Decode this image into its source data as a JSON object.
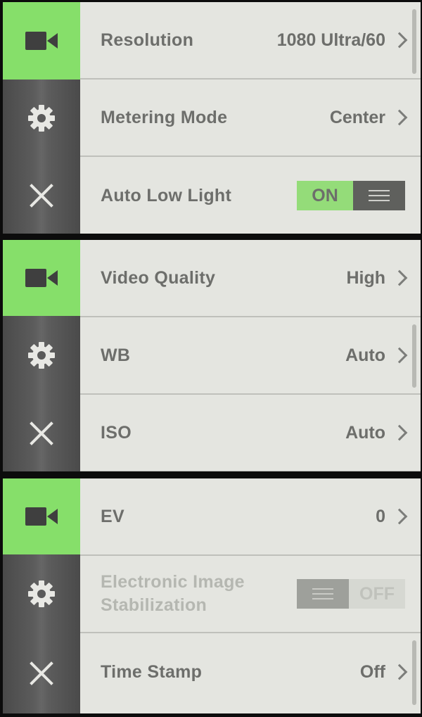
{
  "colors": {
    "accent_green": "#86df6a",
    "sidebar_gray": "#555555",
    "panel_bg": "#e4e5e0",
    "text_gray": "#6d6e6b",
    "disabled_text": "#b5b7b1"
  },
  "sidebar_icons": [
    "video-camera-icon",
    "gear-icon",
    "close-icon"
  ],
  "screens": [
    {
      "active_sidebar": "video-camera-icon",
      "rows": [
        {
          "label": "Resolution",
          "value": "1080 Ultra/60",
          "control": "chevron"
        },
        {
          "label": "Metering Mode",
          "value": "Center",
          "control": "chevron"
        },
        {
          "label": "Auto Low Light",
          "control": "toggle",
          "toggle_state": "ON",
          "toggle_label": "ON"
        }
      ]
    },
    {
      "active_sidebar": "video-camera-icon",
      "rows": [
        {
          "label": "Video Quality",
          "value": "High",
          "control": "chevron"
        },
        {
          "label": "WB",
          "value": "Auto",
          "control": "chevron"
        },
        {
          "label": "ISO",
          "value": "Auto",
          "control": "chevron"
        }
      ]
    },
    {
      "active_sidebar": "video-camera-icon",
      "rows": [
        {
          "label": "EV",
          "value": "0",
          "control": "chevron"
        },
        {
          "label_line1": "Electronic Image",
          "label_line2": "Stabilization",
          "control": "toggle",
          "toggle_state": "OFF",
          "toggle_label": "OFF",
          "disabled": true
        },
        {
          "label": "Time Stamp",
          "value": "Off",
          "control": "chevron"
        }
      ]
    }
  ]
}
